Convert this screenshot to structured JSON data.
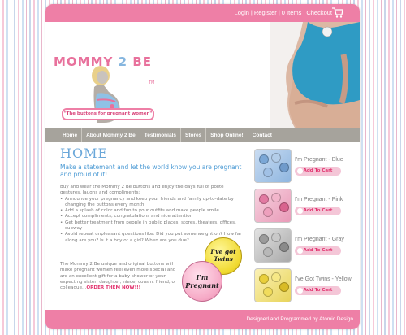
{
  "topbar": {
    "links": [
      "Login",
      "Register",
      "0 Items",
      "Checkout"
    ],
    "separator": "|"
  },
  "logo": {
    "word1": "MOMMY",
    "word2": "2",
    "word3": "BE",
    "tm": "TM",
    "tagline": "\"The buttons for pregnant women\""
  },
  "nav": {
    "items": [
      "Home",
      "About Mommy 2 Be",
      "Testimonials",
      "Stores",
      "Shop Online!",
      "Contact"
    ]
  },
  "main": {
    "title": "HOME",
    "intro": "Make a statement and let the world know you are pregnant and proud of it!",
    "lead": "Buy and wear the Mommy 2 Be buttons and enjoy the days full of polite gestures, laughs and compliments:",
    "bullets": [
      "Announce your pregnancy and keep your friends and family up-to-date by changing the buttons every month",
      "Add a splash of color and fun to your outfits and make people smile",
      "Accept compliments, congratulations and nice attention",
      "Get better treatment from people in public places: stores, theaters, offices, subway",
      "Avoid repeat unpleasant questions like: Did you put some weight on? How far along are you? Is it a boy or a girl? When are you due?"
    ],
    "closing": "The Mommy 2 Be unique and original buttons will make pregnant women feel even more special and are an excellent gift for a baby shower or your expecting sister, daughter, niece, cousin, friend, or colleague...",
    "order_link": "ORDER THEM NOW!!!",
    "badge_twins": [
      "I've got",
      "Twins"
    ],
    "badge_pregnant": [
      "I'm",
      "Pregnant"
    ]
  },
  "products": [
    {
      "name": "I'm Pregnant - Blue",
      "button": "Add To Cart",
      "theme": "blue"
    },
    {
      "name": "I'm Pregnant - Pink",
      "button": "Add To Cart",
      "theme": "pink"
    },
    {
      "name": "I'm Pregnant - Gray",
      "button": "Add To Cart",
      "theme": "gray"
    },
    {
      "name": "I've Got Twins - Yellow",
      "button": "Add To Cart",
      "theme": "yellow"
    }
  ],
  "footer": {
    "credit": "Designed and Programmed by Atomic Design"
  },
  "colors": {
    "brand_pink": "#ee7fa6",
    "nav_gray": "#a6a39c",
    "title_blue": "#6aa7d9",
    "link_red": "#e2346f"
  }
}
